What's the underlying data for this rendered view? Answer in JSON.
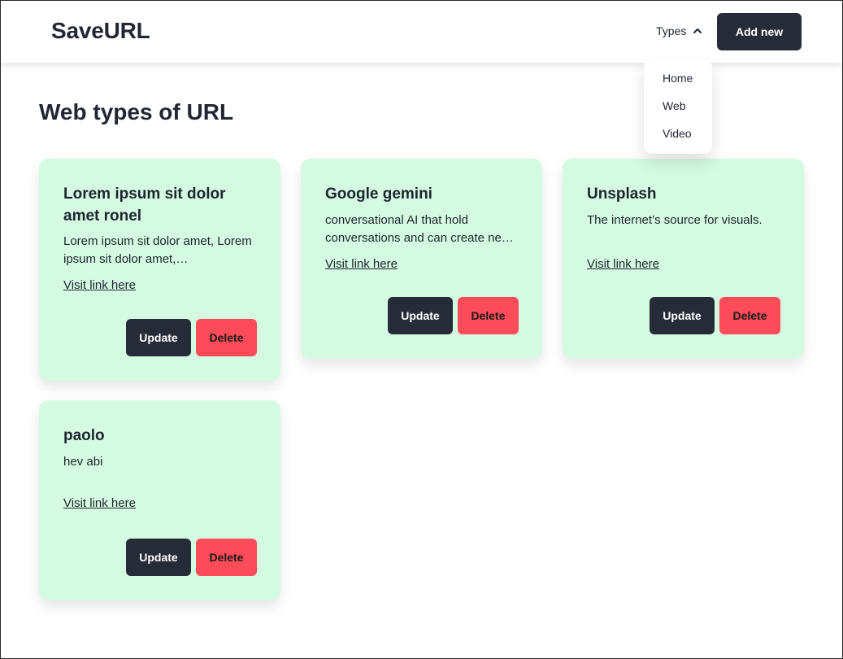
{
  "app": {
    "brand": "SaveURL",
    "types_label": "Types",
    "add_new_label": "Add new"
  },
  "dropdown": {
    "items": [
      {
        "label": "Home"
      },
      {
        "label": "Web"
      },
      {
        "label": "Video"
      }
    ]
  },
  "page": {
    "title": "Web types of URL"
  },
  "cards": [
    {
      "title": "Lorem ipsum sit dolor amet ronel",
      "description": "Lorem ipsum sit dolor amet, Lorem ipsum sit dolor amet,…",
      "link_label": "Visit link here",
      "update_label": "Update",
      "delete_label": "Delete"
    },
    {
      "title": "Google gemini",
      "description": "conversational AI that hold conversations and can create ne…",
      "link_label": "Visit link here",
      "update_label": "Update",
      "delete_label": "Delete"
    },
    {
      "title": "Unsplash",
      "description": "The internet’s source for visuals.",
      "link_label": "Visit link here",
      "update_label": "Update",
      "delete_label": "Delete"
    },
    {
      "title": "paolo",
      "description": "hev abi",
      "link_label": "Visit link here",
      "update_label": "Update",
      "delete_label": "Delete"
    }
  ],
  "colors": {
    "card_bg": "#d4fae1",
    "primary_dark": "#262b38",
    "danger": "#fd4c59"
  }
}
